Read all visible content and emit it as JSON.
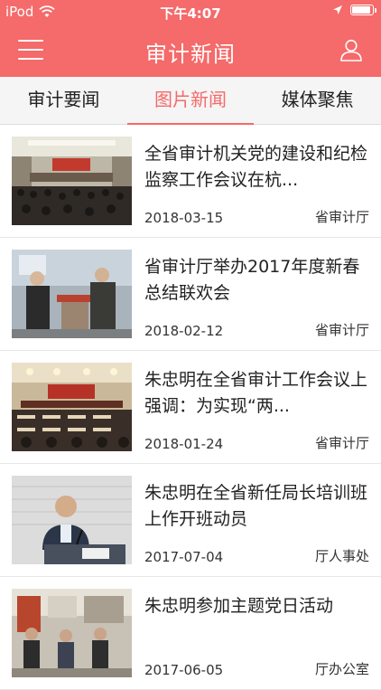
{
  "statusbar": {
    "carrier": "iPod",
    "time": "下午4:07",
    "battery_level": 0.85
  },
  "navbar": {
    "title": "审计新闻",
    "menu_icon": "hamburger-menu-icon",
    "user_icon": "user-profile-icon"
  },
  "tabs": [
    {
      "label": "审计要闻",
      "active": false
    },
    {
      "label": "图片新闻",
      "active": true
    },
    {
      "label": "媒体聚焦",
      "active": false
    }
  ],
  "news": [
    {
      "title": "全省审计机关党的建设和纪检监察工作会议在杭...",
      "date": "2018-03-15",
      "source": "省审计厅"
    },
    {
      "title": "省审计厅举办2017年度新春总结联欢会",
      "date": "2018-02-12",
      "source": "省审计厅"
    },
    {
      "title": "朱忠明在全省审计工作会议上强调：为实现“两...",
      "date": "2018-01-24",
      "source": "省审计厅"
    },
    {
      "title": "朱忠明在全省新任局长培训班上作开班动员",
      "date": "2017-07-04",
      "source": "厅人事处"
    },
    {
      "title": "朱忠明参加主题党日活动",
      "date": "2017-06-05",
      "source": "厅办公室"
    }
  ],
  "colors": {
    "accent": "#f56a6a",
    "background": "#f5f5f5"
  }
}
